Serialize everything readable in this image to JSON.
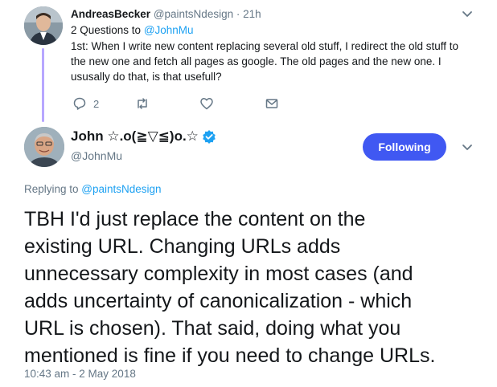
{
  "parent_tweet": {
    "name": "AndreasBecker",
    "handle": "@paintsNdesign",
    "dot": "·",
    "time": "21h",
    "line1_prefix": "2 Questions to ",
    "line1_mention": "@JohnMu",
    "body_lines": [
      "1st: When I write new content replacing several old stuff, I redirect the old stuff to",
      "the new one and fetch all pages as google. The old pages and the new one. I",
      "ususally do that, is that usefull?"
    ],
    "reply_count": "2",
    "icons": {
      "reply": "reply-icon",
      "retweet": "retweet-icon",
      "like": "heart-icon",
      "dm": "mail-icon",
      "menu": "chevron-down-icon"
    }
  },
  "main_tweet": {
    "name": "John ☆.o(≧▽≦)o.☆",
    "handle": "@JohnMu",
    "follow_label": "Following",
    "replying_prefix": "Replying to ",
    "replying_mention": "@paintsNdesign",
    "body_lines": [
      "TBH I'd just replace the content on the",
      "existing URL. Changing URLs adds",
      "unnecessary complexity in most cases (and",
      "adds uncertainty of canonicalization - which",
      "URL is chosen). That said, doing what you",
      "mentioned is fine if you need to change URLs."
    ],
    "timestamp": "10:43 am - 2 May 2018",
    "colors": {
      "button": "#4058f2",
      "link": "#1da1f2",
      "verified": "#1da1f2",
      "thread": "#b7a7ff"
    }
  }
}
